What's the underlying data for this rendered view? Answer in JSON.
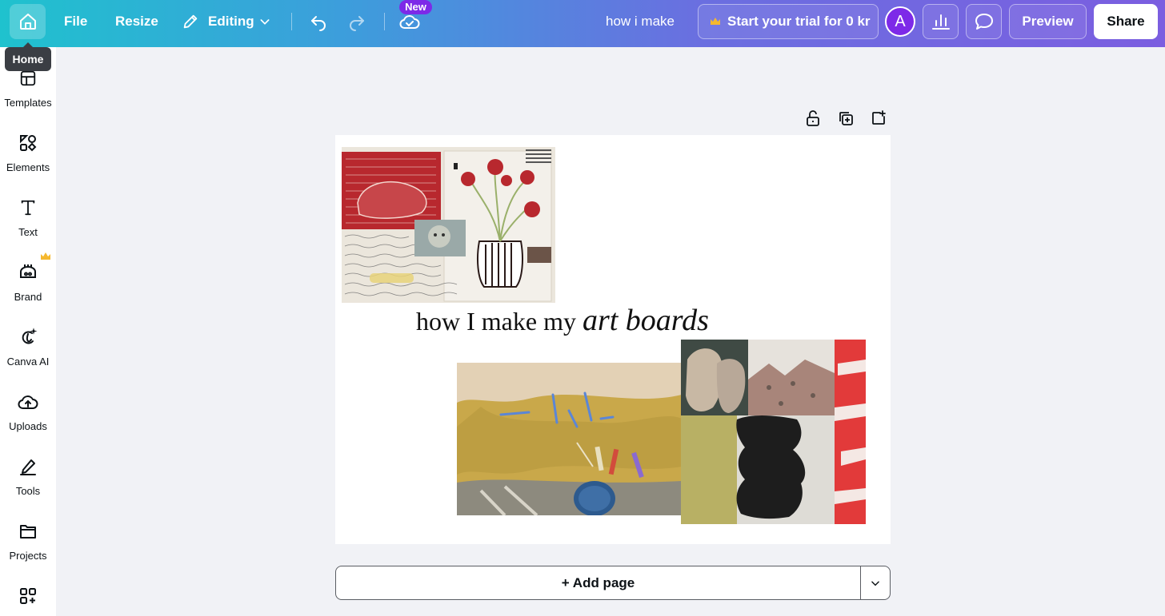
{
  "topbar": {
    "file_label": "File",
    "resize_label": "Resize",
    "editing_label": "Editing",
    "new_badge": "New",
    "doc_title": "how i make",
    "trial_label": "Start your trial for 0 kr",
    "avatar_initial": "A",
    "preview_label": "Preview",
    "share_label": "Share",
    "colors": {
      "accent_purple": "#7d2ae8",
      "gradient_start": "#1fc2ce",
      "gradient_end": "#7b5ee0",
      "crown": "#f5b82e"
    }
  },
  "tooltip": {
    "home": "Home"
  },
  "sidebar": {
    "items": [
      {
        "label": "Templates",
        "icon": "templates-icon"
      },
      {
        "label": "Elements",
        "icon": "elements-icon"
      },
      {
        "label": "Text",
        "icon": "text-icon"
      },
      {
        "label": "Brand",
        "icon": "brand-icon"
      },
      {
        "label": "Canva AI",
        "icon": "canva-ai-icon"
      },
      {
        "label": "Uploads",
        "icon": "uploads-icon"
      },
      {
        "label": "Tools",
        "icon": "tools-icon"
      },
      {
        "label": "Projects",
        "icon": "projects-icon"
      },
      {
        "label": "",
        "icon": "apps-icon"
      }
    ]
  },
  "canvas": {
    "heading_regular": "how I make my ",
    "heading_italic": "art boards"
  },
  "footer": {
    "add_page_label": "+ Add page"
  }
}
